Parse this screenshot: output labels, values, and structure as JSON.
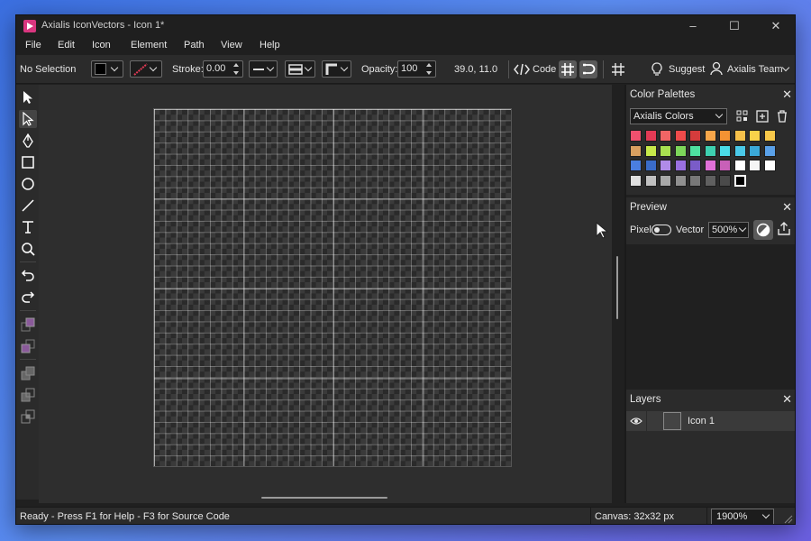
{
  "window": {
    "title": "Axialis IconVectors - Icon 1*"
  },
  "menu": [
    "File",
    "Edit",
    "Icon",
    "Element",
    "Path",
    "View",
    "Help"
  ],
  "toolbar": {
    "selection_label": "No Selection",
    "stroke_label": "Stroke:",
    "stroke_value": "0.00",
    "opacity_label": "Opacity:",
    "opacity_value": "100",
    "coordinates": "39.0, 11.0",
    "code_label": "Code",
    "suggest_label": "Suggest",
    "account_label": "Axialis Team"
  },
  "palettes": {
    "title": "Color Palettes",
    "selected": "Axialis Colors",
    "swatches": [
      [
        "#f0506e",
        "#e23a55",
        "#f06565",
        "#ee4b4b",
        "#d43c3c",
        "#f7a64a",
        "#f39233",
        "#f5c04a",
        "#f8d24a",
        "#f7c84a"
      ],
      [
        "#d9a060",
        "#c7e84a",
        "#a8e050",
        "#7dd65a",
        "#4ee0a0",
        "#3ed0b0",
        "#4adce8",
        "#4ac8e8",
        "#3aa8d8",
        "#5aa0e8"
      ],
      [
        "#4a7ee0",
        "#3a6cc8",
        "#b08be8",
        "#9a70e0",
        "#7a5cc8",
        "#e070d8",
        "#c860b8",
        "#ffffff",
        "#f5f5f5",
        "#ffffff"
      ],
      [
        "#e0e0e0",
        "#c0c0c0",
        "#a8a8a8",
        "#909090",
        "#787878",
        "#606060",
        "#4a4a4a",
        "#000000"
      ]
    ]
  },
  "preview": {
    "title": "Preview",
    "pixel_label": "Pixel",
    "vector_label": "Vector",
    "zoom": "500%"
  },
  "layers": {
    "title": "Layers",
    "items": [
      {
        "name": "Icon 1"
      }
    ]
  },
  "status": {
    "help": "Ready - Press F1 for Help - F3 for Source Code",
    "canvas": "Canvas: 32x32 px",
    "zoom": "1900%"
  },
  "colors": {
    "accent": "#d9367f",
    "background": "#202020",
    "panel": "#2b2b2b"
  }
}
